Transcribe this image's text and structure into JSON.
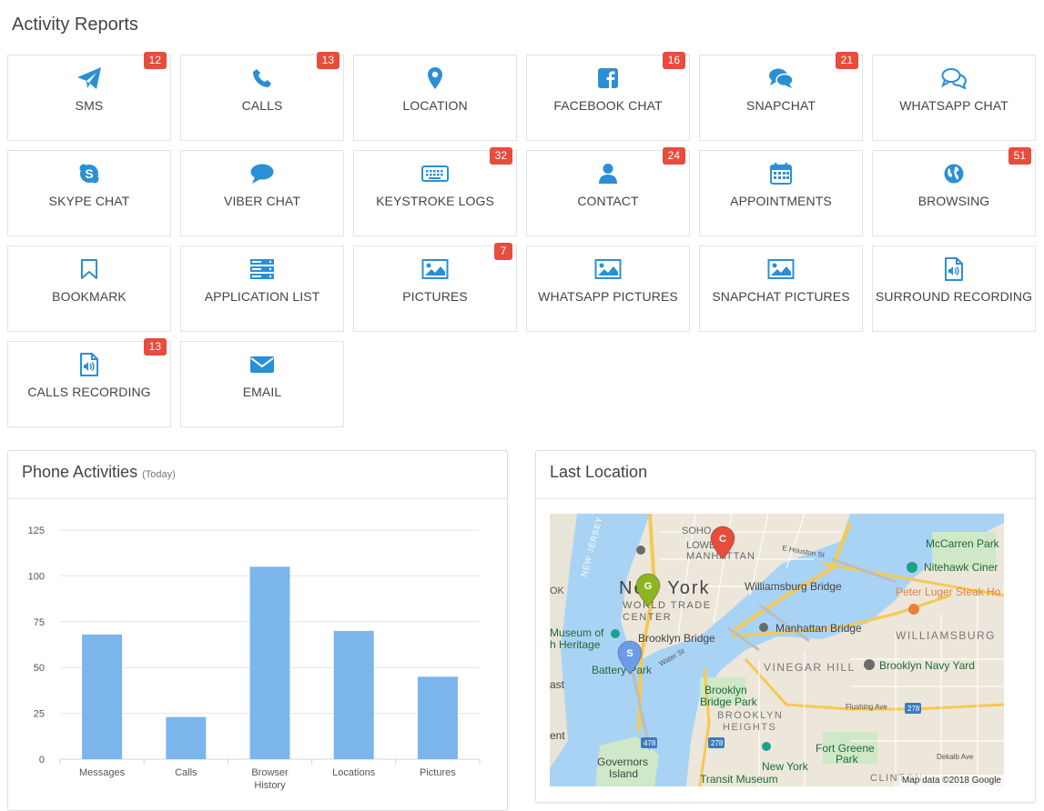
{
  "page_title": "Activity Reports",
  "colors": {
    "accent": "#2b8fd6",
    "badge": "#e74c3c",
    "bar": "#7cb5ec"
  },
  "tiles": [
    {
      "label": "SMS",
      "icon": "paper-plane-icon",
      "badge": "12"
    },
    {
      "label": "CALLS",
      "icon": "phone-icon",
      "badge": "13"
    },
    {
      "label": "LOCATION",
      "icon": "map-marker-icon",
      "badge": ""
    },
    {
      "label": "FACEBOOK CHAT",
      "icon": "facebook-icon",
      "badge": "16"
    },
    {
      "label": "SNAPCHAT",
      "icon": "comments-icon",
      "badge": "21"
    },
    {
      "label": "WHATSAPP CHAT",
      "icon": "comments-outline-icon",
      "badge": ""
    },
    {
      "label": "SKYPE CHAT",
      "icon": "skype-icon",
      "badge": ""
    },
    {
      "label": "VIBER CHAT",
      "icon": "comment-icon",
      "badge": ""
    },
    {
      "label": "KEYSTROKE LOGS",
      "icon": "keyboard-icon",
      "badge": "32"
    },
    {
      "label": "CONTACT",
      "icon": "user-icon",
      "badge": "24"
    },
    {
      "label": "APPOINTMENTS",
      "icon": "calendar-icon",
      "badge": ""
    },
    {
      "label": "BROWSING",
      "icon": "globe-icon",
      "badge": "51"
    },
    {
      "label": "BOOKMARK",
      "icon": "bookmark-icon",
      "badge": ""
    },
    {
      "label": "APPLICATION LIST",
      "icon": "server-icon",
      "badge": ""
    },
    {
      "label": "PICTURES",
      "icon": "image-icon",
      "badge": "7"
    },
    {
      "label": "WHATSAPP PICTURES",
      "icon": "image-icon",
      "badge": ""
    },
    {
      "label": "SNAPCHAT PICTURES",
      "icon": "image-icon",
      "badge": ""
    },
    {
      "label": "SURROUND RECORDING",
      "icon": "audio-file-icon",
      "badge": ""
    },
    {
      "label": "CALLS RECORDING",
      "icon": "audio-file-icon",
      "badge": "13"
    },
    {
      "label": "EMAIL",
      "icon": "envelope-icon",
      "badge": ""
    }
  ],
  "phone_panel": {
    "title": "Phone Activities",
    "subtitle": "(Today)"
  },
  "chart_data": {
    "type": "bar",
    "categories": [
      "Messages",
      "Calls",
      "Browser History",
      "Locations",
      "Pictures"
    ],
    "values": [
      68,
      23,
      105,
      70,
      45
    ],
    "ylim": [
      0,
      125
    ],
    "yticks": [
      0,
      25,
      50,
      75,
      100,
      125
    ],
    "title": "",
    "xlabel": "",
    "ylabel": "",
    "grid": true
  },
  "location_panel": {
    "title": "Last Location",
    "map_attribution": "Map data ©2018 Google",
    "map_labels": {
      "soho": "SOHO",
      "lower": "LOWER",
      "manhattan": "MANHATTAN",
      "new_york": "New York",
      "world_trade": "WORLD TRADE",
      "center": "CENTER",
      "new_jersey": "NEW JERSEY",
      "williamsburg_bridge": "Williamsburg Bridge",
      "manhattan_bridge": "Manhattan Bridge",
      "brooklyn_bridge": "Brooklyn Bridge",
      "battery_park": "Battery Park",
      "museum_of": "Museum of",
      "heritage": "h Heritage",
      "vinegar_hill": "VINEGAR HILL",
      "navy_yard": "Brooklyn Navy Yard",
      "williamsburg": "WILLIAMSBURG",
      "mccarren": "McCarren Park",
      "nitehawk": "Nitehawk Ciner",
      "peter_luger": "Peter Luger Steak Ho",
      "bb_park_1": "Brooklyn",
      "bb_park_2": "Bridge Park",
      "bk_heights_1": "BROOKLYN",
      "bk_heights_2": "HEIGHTS",
      "governors_1": "Governors",
      "governors_2": "Island",
      "ny_transit_1": "New York",
      "ny_transit_2": "Transit Museum",
      "fort_greene_1": "Fort Greene",
      "fort_greene_2": "Park",
      "clinton": "CLINTON",
      "e_houston": "E Houston St",
      "flushing": "Flushing Ave",
      "dekalb": "Dekalb Ave",
      "water_st": "Water St",
      "route_478_a": "478",
      "route_278_a": "278",
      "route_278_b": "278",
      "left_ok": "OK",
      "left_ast": "ast",
      "left_ent": "ent"
    },
    "markers": [
      {
        "letter": "C",
        "color": "#e74c3c"
      },
      {
        "letter": "G",
        "color": "#8db522"
      },
      {
        "letter": "S",
        "color": "#6c9be8"
      }
    ]
  }
}
